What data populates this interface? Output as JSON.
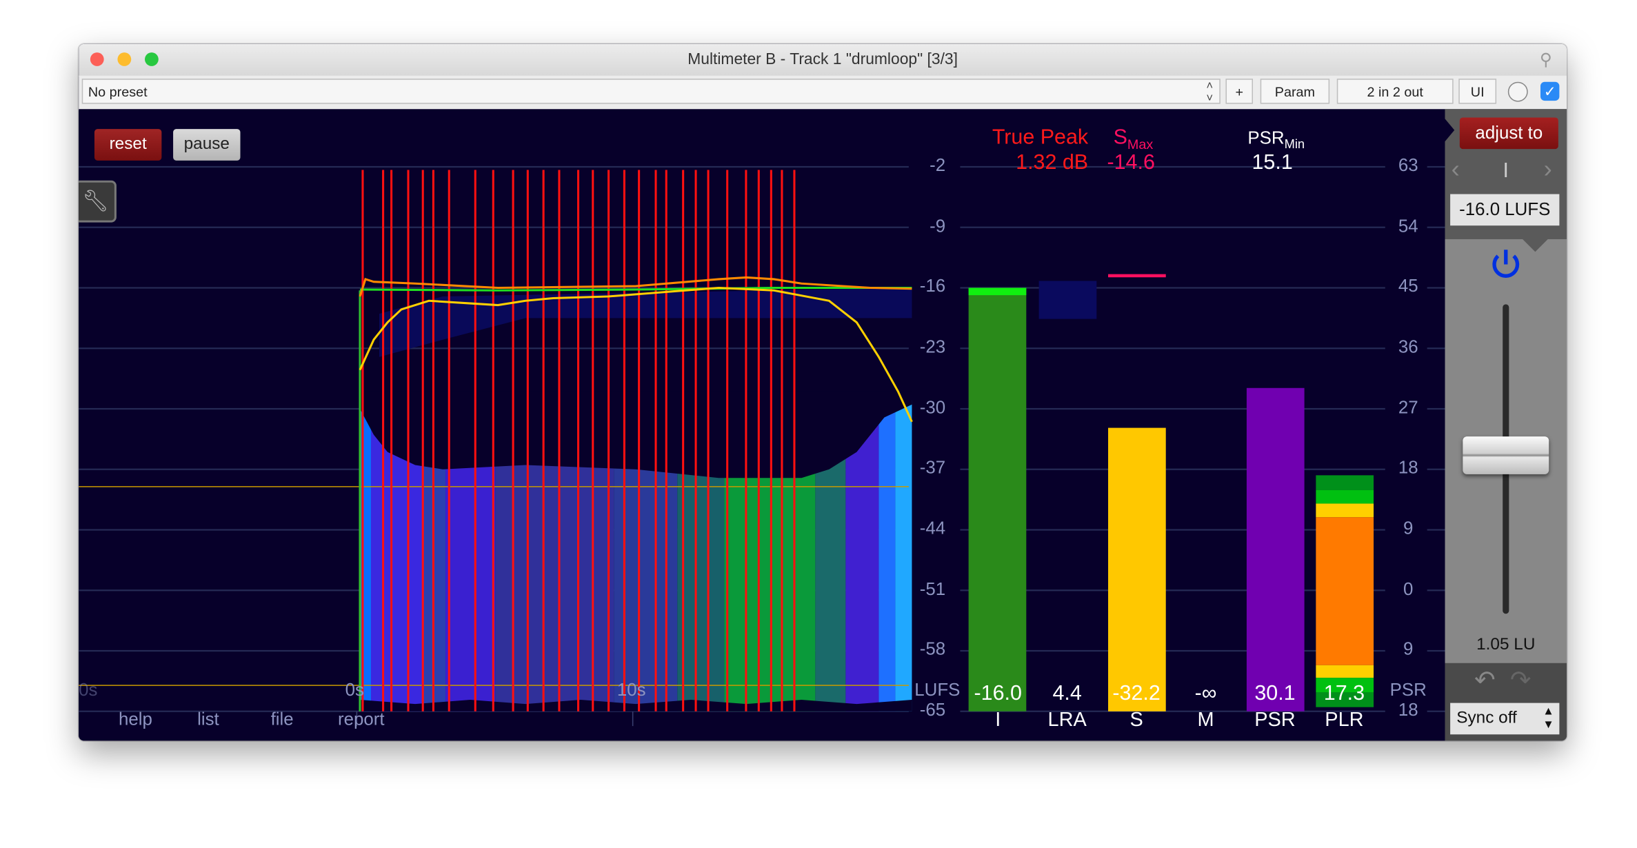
{
  "window": {
    "title": "Multimeter B - Track 1 \"drumloop\" [3/3]"
  },
  "toolbar": {
    "preset": "No preset",
    "plus": "+",
    "param": "Param",
    "io": "2 in 2 out",
    "ui": "UI",
    "bypass_checked": true
  },
  "controls": {
    "reset": "reset",
    "pause": "pause"
  },
  "readouts": {
    "true_peak_label": "True Peak",
    "true_peak_value": "1.32 dB",
    "smax_label": "S",
    "smax_sub": "Max",
    "smax_value": "-14.6",
    "psrmin_label": "PSR",
    "psrmin_sub": "Min",
    "psrmin_value": "15.1"
  },
  "left_axis": {
    "ticks": [
      "-2",
      "-9",
      "-16",
      "-23",
      "-30",
      "-37",
      "-44",
      "-51",
      "-58",
      "-65"
    ],
    "unit": "LUFS"
  },
  "right_axis": {
    "ticks": [
      "63",
      "54",
      "45",
      "36",
      "27",
      "18",
      "9",
      "0",
      "9",
      "18"
    ],
    "unit": "PSR"
  },
  "time_axis": {
    "labels": [
      "0s",
      "0s",
      "10s"
    ]
  },
  "links": [
    "help",
    "list",
    "file",
    "report"
  ],
  "meters": [
    {
      "label": "I",
      "value": "-16.0"
    },
    {
      "label": "LRA",
      "value": "4.4"
    },
    {
      "label": "S",
      "value": "-32.2"
    },
    {
      "label": "M",
      "value": "-∞"
    },
    {
      "label": "PSR",
      "value": "30.1"
    },
    {
      "label": "PLR",
      "value": "17.3"
    }
  ],
  "right_panel": {
    "adjust_to": "adjust to",
    "mode": "I",
    "target": "-16.0 LUFS",
    "gain": "1.05 LU",
    "sync": "Sync off",
    "gain_slider_fraction": 0.5
  },
  "colors": {
    "background": "#07002a",
    "integrated": "#2a8a1a",
    "short_term": "#ffc800",
    "psr": "#7000b0",
    "true_peak": "#ff1a1a",
    "smax": "#ff1060",
    "adjust": "#8b1a1a",
    "power": "#0030e0"
  },
  "chart_data": {
    "type": "line",
    "ylim": [
      -65,
      -2
    ],
    "xlim_s": [
      0,
      20
    ],
    "true_peak_overs_s": [
      0.1,
      0.84,
      1.14,
      1.75,
      2.28,
      2.66,
      3.23,
      4.18,
      4.83,
      5.55,
      6.08,
      6.65,
      7.22,
      7.91,
      8.44,
      9.01,
      9.58,
      10.11,
      10.72,
      11.1,
      11.71,
      12.17,
      12.62,
      13.31,
      13.99,
      14.45,
      14.9,
      15.29,
      15.74
    ],
    "short_term": [
      [
        0,
        -25.5
      ],
      [
        0.5,
        -22
      ],
      [
        1,
        -20
      ],
      [
        1.5,
        -18.5
      ],
      [
        2.5,
        -17.5
      ],
      [
        4,
        -17.8
      ],
      [
        5,
        -18
      ],
      [
        6,
        -17.5
      ],
      [
        7,
        -17.2
      ],
      [
        9,
        -17
      ],
      [
        11,
        -16.5
      ],
      [
        13,
        -16
      ],
      [
        15,
        -16.3
      ],
      [
        17,
        -17.5
      ],
      [
        18,
        -20
      ],
      [
        18.8,
        -24
      ],
      [
        19.5,
        -28
      ],
      [
        20,
        -31.5
      ]
    ],
    "short_term_max": [
      [
        0,
        -17
      ],
      [
        0.2,
        -15
      ],
      [
        0.5,
        -15.3
      ],
      [
        2,
        -15.5
      ],
      [
        5,
        -16
      ],
      [
        10,
        -15.8
      ],
      [
        13,
        -15
      ],
      [
        14,
        -14.8
      ],
      [
        15,
        -15
      ],
      [
        16,
        -15.5
      ],
      [
        18.5,
        -16
      ],
      [
        20,
        -16.1
      ]
    ],
    "integrated": [
      [
        0,
        -16.2
      ],
      [
        5,
        -16.3
      ],
      [
        10,
        -16.2
      ],
      [
        15,
        -16
      ],
      [
        20,
        -16
      ]
    ],
    "lra_band_upper": [
      [
        0.7,
        -19
      ],
      [
        3,
        -17
      ],
      [
        20,
        -16
      ]
    ],
    "lra_band_lower": [
      [
        20,
        -19.5
      ],
      [
        6,
        -19.5
      ],
      [
        3,
        -22
      ],
      [
        0.7,
        -24
      ]
    ],
    "momentary_envelope": [
      [
        0,
        -30
      ],
      [
        0.5,
        -33
      ],
      [
        1,
        -35
      ],
      [
        2,
        -36.5
      ],
      [
        3,
        -37
      ],
      [
        6,
        -36.5
      ],
      [
        10,
        -37
      ],
      [
        13,
        -38
      ],
      [
        16,
        -38
      ],
      [
        17,
        -37
      ],
      [
        18,
        -35
      ],
      [
        19,
        -31
      ],
      [
        20,
        -29.5
      ]
    ],
    "psr_segments": [
      [
        0,
        0.4,
        "#0a6cff"
      ],
      [
        0.4,
        2.3,
        "#3a28e0"
      ],
      [
        2.3,
        3.1,
        "#2a40b0"
      ],
      [
        3.1,
        4.9,
        "#3a20d0"
      ],
      [
        4.9,
        9.2,
        "#30309a"
      ],
      [
        9.2,
        11.5,
        "#2a3a9a"
      ],
      [
        11.5,
        13.2,
        "#17606a"
      ],
      [
        13.2,
        16.5,
        "#0a9a3a"
      ],
      [
        16.5,
        17.6,
        "#1a6a6a"
      ],
      [
        17.6,
        18.8,
        "#4020d0"
      ],
      [
        18.8,
        19.4,
        "#1e70ff"
      ],
      [
        19.4,
        20,
        "#20a8ff"
      ]
    ],
    "reference_levels": [
      -39,
      -62
    ]
  }
}
